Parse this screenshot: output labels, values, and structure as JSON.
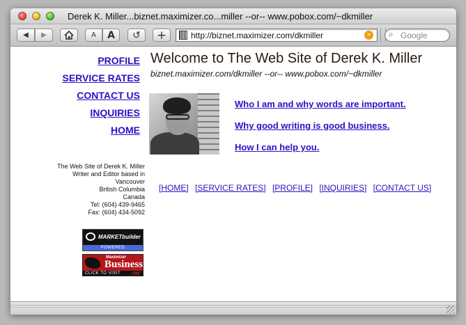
{
  "window": {
    "title": "Derek K. Miller...biznet.maximizer.co...miller --or-- www.pobox.com/~dkmiller"
  },
  "toolbar": {
    "back_icon": "◀",
    "forward_icon": "▶",
    "home_icon": "⌂",
    "text_smaller_label": "A",
    "text_bigger_label": "A",
    "reload_icon": "↺",
    "add_bookmark_icon": "+",
    "address": "http://biznet.maximizer.com/dkmiller",
    "rss_icon": "»",
    "search_icon": "⌕",
    "search_placeholder": "Google"
  },
  "sidebar": {
    "links": [
      {
        "label": "PROFILE"
      },
      {
        "label": "SERVICE RATES"
      },
      {
        "label": "CONTACT US"
      },
      {
        "label": "INQUIRIES"
      },
      {
        "label": "HOME"
      }
    ],
    "address_lines": [
      "The Web Site of Derek K. Miller",
      "Writer and Editor based in",
      "Vancouver",
      "British Columbia",
      "Canada",
      "Tel: (604) 439-9465",
      "Fax: (604) 434-5092"
    ],
    "badges": {
      "marketbuilder": {
        "name": "MARKETbuilder",
        "strip": "POWERED"
      },
      "business": {
        "small": "Maximizer",
        "big": "Business",
        "strip": "CLICK TO VISIT",
        "suffix": ".net"
      }
    }
  },
  "main": {
    "heading": "Welcome to The Web Site of Derek K. Miller",
    "subheading": "biznet.maximizer.com/dkmiller --or-- www.pobox.com/~dkmiller",
    "taglines": [
      {
        "label": "Who I am and why words are important."
      },
      {
        "label": "Why good writing is good business."
      },
      {
        "label": "How I can help you."
      }
    ],
    "bottom_nav": [
      "[HOME]",
      "[SERVICE RATES]",
      "[PROFILE]",
      "[INQUIRIES]",
      "[CONTACT US]"
    ]
  }
}
